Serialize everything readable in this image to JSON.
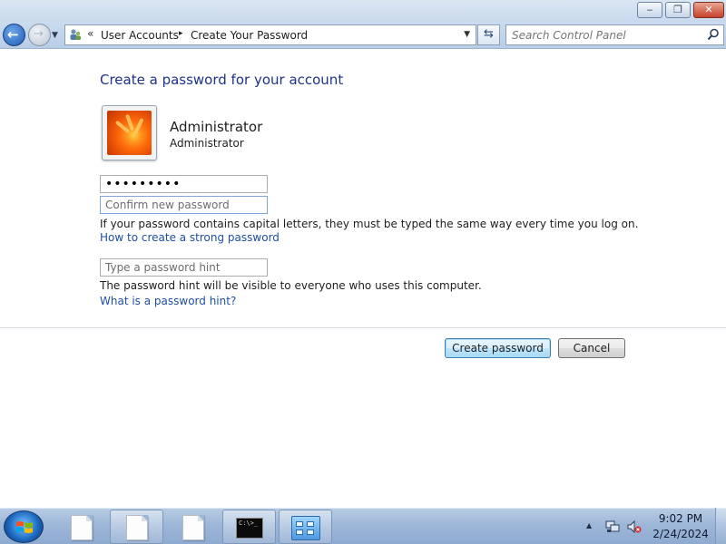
{
  "window": {
    "controls": {
      "minimize": "‒",
      "maximize": "❐",
      "close": "✕"
    }
  },
  "navbar": {
    "back_icon": "back-arrow-icon",
    "forward_icon": "forward-arrow-icon",
    "breadcrumb": {
      "separator_prefix": "«",
      "items": [
        "User Accounts",
        "Create Your Password"
      ],
      "separator": "▸"
    },
    "search": {
      "placeholder": "Search Control Panel"
    }
  },
  "content": {
    "heading": "Create a password for your account",
    "account": {
      "name": "Administrator",
      "type": "Administrator"
    },
    "password_value": "•••••••••",
    "confirm_placeholder": "Confirm new password",
    "capital_letters_note": "If your password contains capital letters, they must be typed the same way every time you log on.",
    "strong_password_link": "How to create a strong password",
    "hint_placeholder": "Type a password hint",
    "hint_note": "The password hint will be visible to everyone who uses this computer.",
    "hint_link": "What is a password hint?",
    "buttons": {
      "create": "Create password",
      "cancel": "Cancel"
    }
  },
  "taskbar": {
    "items": [
      "explorer-doc",
      "explorer-doc",
      "explorer-doc",
      "command-prompt",
      "control-panel"
    ],
    "cmd_text": "C:\\>_",
    "clock": {
      "time": "9:02 PM",
      "date": "2/24/2024"
    }
  },
  "colors": {
    "heading": "#1e3287",
    "link": "#1f4fa3",
    "primary_button_border": "#3c7fb1"
  }
}
